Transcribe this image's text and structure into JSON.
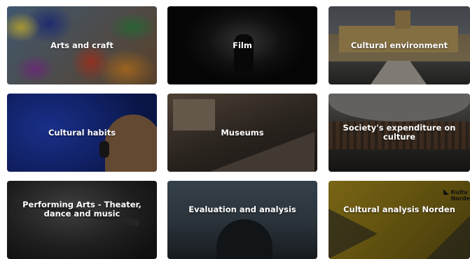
{
  "tiles": [
    {
      "label": "Arts and craft"
    },
    {
      "label": "Film"
    },
    {
      "label": "Cultural environment"
    },
    {
      "label": "Cultural habits"
    },
    {
      "label": "Museums"
    },
    {
      "label": "Society's expenditure on culture"
    },
    {
      "label": "Performing Arts - Theater, dance and music"
    },
    {
      "label": "Evaluation and analysis"
    },
    {
      "label": "Cultural analysis Norden"
    }
  ],
  "logo": {
    "line1": "Kultu",
    "line2": "Norde"
  }
}
